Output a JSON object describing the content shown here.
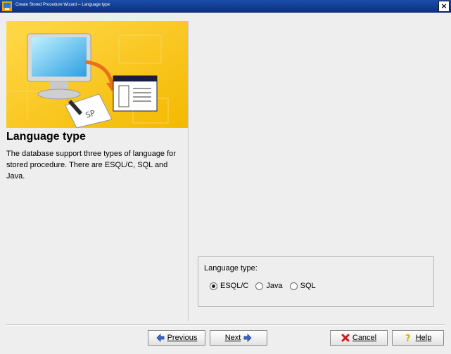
{
  "window": {
    "title": "Create Stored Procedure Wizard -- Language type",
    "close_glyph": "×"
  },
  "left": {
    "title": "Language type",
    "description": "The database support three types of language for stored procedure. There are ESQL/C, SQL and Java.",
    "banner_badge": "SP"
  },
  "form": {
    "group_label": "Language type:",
    "options": [
      {
        "label": "ESQL/C",
        "checked": true
      },
      {
        "label": "Java",
        "checked": false
      },
      {
        "label": "SQL",
        "checked": false
      }
    ]
  },
  "buttons": {
    "previous": "Previous",
    "next": "Next",
    "cancel": "Cancel",
    "help": "Help"
  },
  "icons": [
    "app-icon",
    "close-icon",
    "previous-arrow-icon",
    "next-arrow-icon",
    "cancel-x-icon",
    "help-question-icon"
  ],
  "colors": {
    "titlebar": "#0b2f7d",
    "banner": "#f5c51d",
    "nav_arrow": "#3b66c9",
    "cancel_x": "#d11b1b",
    "help_q": "#d8b000"
  }
}
